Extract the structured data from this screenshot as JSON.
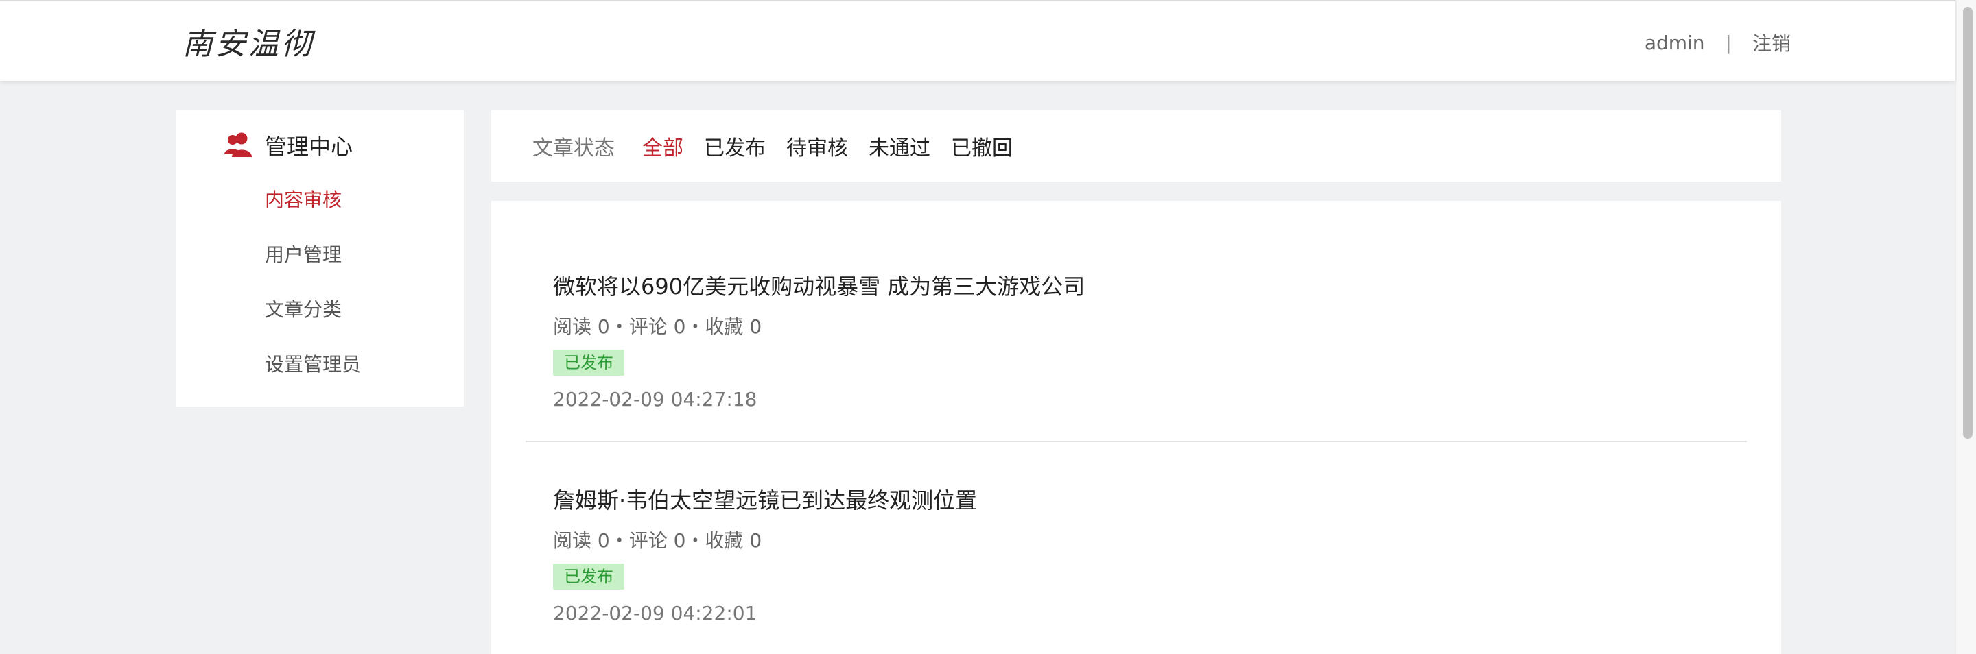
{
  "header": {
    "logo": "南安温彻",
    "user": "admin",
    "separator": "|",
    "logout": "注销"
  },
  "sidebar": {
    "title": "管理中心",
    "items": [
      {
        "label": "内容审核",
        "active": true
      },
      {
        "label": "用户管理"
      },
      {
        "label": "文章分类"
      },
      {
        "label": "设置管理员"
      }
    ]
  },
  "filter": {
    "label": "文章状态",
    "options": [
      "全部",
      "已发布",
      "待审核",
      "未通过",
      "已撤回"
    ],
    "active": "全部"
  },
  "articles": [
    {
      "title": "微软将以690亿美元收购动视暴雪 成为第三大游戏公司",
      "stats": "阅读 0・评论 0・收藏 0",
      "status": "已发布",
      "time": "2022-02-09 04:27:18"
    },
    {
      "title": "詹姆斯·韦伯太空望远镜已到达最终观测位置",
      "stats": "阅读 0・评论 0・收藏 0",
      "status": "已发布",
      "time": "2022-02-09 04:22:01"
    }
  ],
  "colors": {
    "accent": "#c2242d",
    "badge_bg": "#c8f0c6",
    "badge_text": "#2e9c36",
    "background": "#f0f1f3"
  },
  "icons": {
    "sidebar_title": "user-group-icon"
  }
}
